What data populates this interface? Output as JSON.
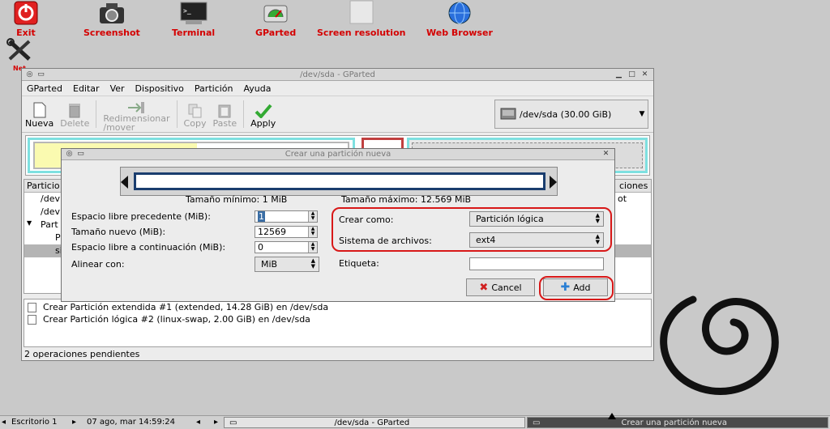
{
  "desktop": {
    "icons": [
      {
        "label": "Exit",
        "icon": "power-icon"
      },
      {
        "label": "Screenshot",
        "icon": "camera-icon"
      },
      {
        "label": "Terminal",
        "icon": "terminal-icon"
      },
      {
        "label": "GParted",
        "icon": "gparted-icon"
      },
      {
        "label": "Screen resolution",
        "icon": "monitor-icon"
      },
      {
        "label": "Web Browser",
        "icon": "globe-icon"
      }
    ],
    "partial_icon_label": "Net"
  },
  "main_window": {
    "title": "/dev/sda - GParted",
    "menu": [
      "GParted",
      "Editar",
      "Ver",
      "Dispositivo",
      "Partición",
      "Ayuda"
    ],
    "toolbar": {
      "new": "Nueva",
      "delete": "Delete",
      "resize_line1": "Redimensionar",
      "resize_line2": "/mover",
      "copy": "Copy",
      "paste": "Paste",
      "apply": "Apply"
    },
    "device_selector": "/dev/sda  (30.00 GiB)",
    "partition_table": {
      "col_partition": "Particio",
      "col_flags": "ciones",
      "rows": [
        {
          "name": "/dev",
          "flags": "ot"
        },
        {
          "name": "/dev",
          "flags": ""
        },
        {
          "name": "Part",
          "flags": ""
        },
        {
          "name": "P",
          "flags": ""
        },
        {
          "name": "si",
          "flags": ""
        }
      ]
    },
    "operations": [
      "Crear Partición extendida #1 (extended, 14.28 GiB) en /dev/sda",
      "Crear Partición lógica #2 (linux-swap, 2.00 GiB) en /dev/sda"
    ],
    "status": "2 operaciones pendientes"
  },
  "dialog": {
    "title": "Crear una partición nueva",
    "min_size": "Tamaño mínimo: 1 MiB",
    "max_size": "Tamaño máximo: 12.569 MiB",
    "free_before_label": "Espacio libre precedente (MiB):",
    "free_before_value": "1",
    "new_size_label": "Tamaño nuevo (MiB):",
    "new_size_value": "12569",
    "free_after_label": "Espacio libre a continuación (MiB):",
    "free_after_value": "0",
    "align_label": "Alinear con:",
    "align_value": "MiB",
    "create_as_label": "Crear como:",
    "create_as_value": "Partición lógica",
    "filesystem_label": "Sistema de archivos:",
    "filesystem_value": "ext4",
    "label_label": "Etiqueta:",
    "label_value": "",
    "cancel": "Cancel",
    "add": "Add"
  },
  "taskbar": {
    "desktop": "Escritorio 1",
    "clock": "07 ago, mar 14:59:24",
    "task1": "/dev/sda - GParted",
    "task2": "Crear una partición nueva"
  },
  "colors": {
    "desktop_label": "#d40000",
    "highlight": "#d81818",
    "extended_partition": "#7ee0e0",
    "swap_partition": "#c04040",
    "progress_border": "#1a3d6e"
  }
}
